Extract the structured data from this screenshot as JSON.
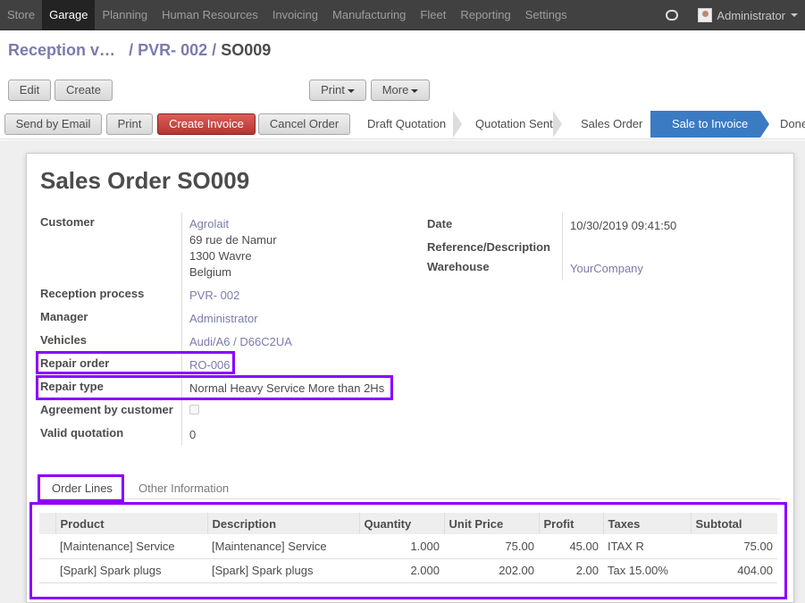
{
  "topbar": {
    "menu": [
      "Store",
      "Garage",
      "Planning",
      "Human Resources",
      "Invoicing",
      "Manufacturing",
      "Fleet",
      "Reporting",
      "Settings"
    ],
    "active_menu": "Garage",
    "user": "Administrator"
  },
  "breadcrumb": {
    "first": "Reception v…",
    "second": "PVR- 002",
    "current": "SO009",
    "sep": "/"
  },
  "toolbar": {
    "edit": "Edit",
    "create": "Create",
    "print": "Print",
    "more": "More"
  },
  "actions": {
    "send_by_email": "Send by Email",
    "print": "Print",
    "create_invoice": "Create Invoice",
    "cancel_order": "Cancel Order"
  },
  "stages": [
    "Draft Quotation",
    "Quotation Sent",
    "Sales Order",
    "Sale to Invoice",
    "Done"
  ],
  "active_stage": "Sale to Invoice",
  "form": {
    "title_prefix": "Sales Order",
    "title_number": "SO009",
    "customer_label": "Customer",
    "customer_name": "Agrolait",
    "customer_address": [
      "69 rue de Namur",
      "1300 Wavre",
      "Belgium"
    ],
    "reception_label": "Reception process",
    "reception_value": "PVR- 002",
    "manager_label": "Manager",
    "manager_value": "Administrator",
    "vehicles_label": "Vehicles",
    "vehicles_value": "Audi/A6 / D66C2UA",
    "repair_order_label": "Repair order",
    "repair_order_value": "RO-006",
    "repair_type_label": "Repair type",
    "repair_type_value": "Normal Heavy Service More than 2Hs",
    "agreement_label": "Agreement by customer",
    "valid_quotation_label": "Valid quotation",
    "valid_quotation_value": "0",
    "date_label": "Date",
    "date_value": "10/30/2019 09:41:50",
    "reference_label": "Reference/Description",
    "warehouse_label": "Warehouse",
    "warehouse_value": "YourCompany"
  },
  "tabs": {
    "order_lines": "Order Lines",
    "other_information": "Other Information"
  },
  "order_lines": {
    "headers": [
      "Product",
      "Description",
      "Quantity",
      "Unit Price",
      "Profit",
      "Taxes",
      "Subtotal"
    ],
    "rows": [
      [
        "[Maintenance] Service",
        "[Maintenance] Service",
        "1.000",
        "75.00",
        "45.00",
        "ITAX R",
        "75.00"
      ],
      [
        "[Spark] Spark plugs",
        "[Spark] Spark plugs",
        "2.000",
        "202.00",
        "2.00",
        "Tax 15.00%",
        "404.00"
      ]
    ]
  },
  "colors": {
    "highlight": "#8a00ff",
    "link": "#7c7bad",
    "active_stage": "#3b7bc4",
    "create_invoice": "#c9423c"
  }
}
